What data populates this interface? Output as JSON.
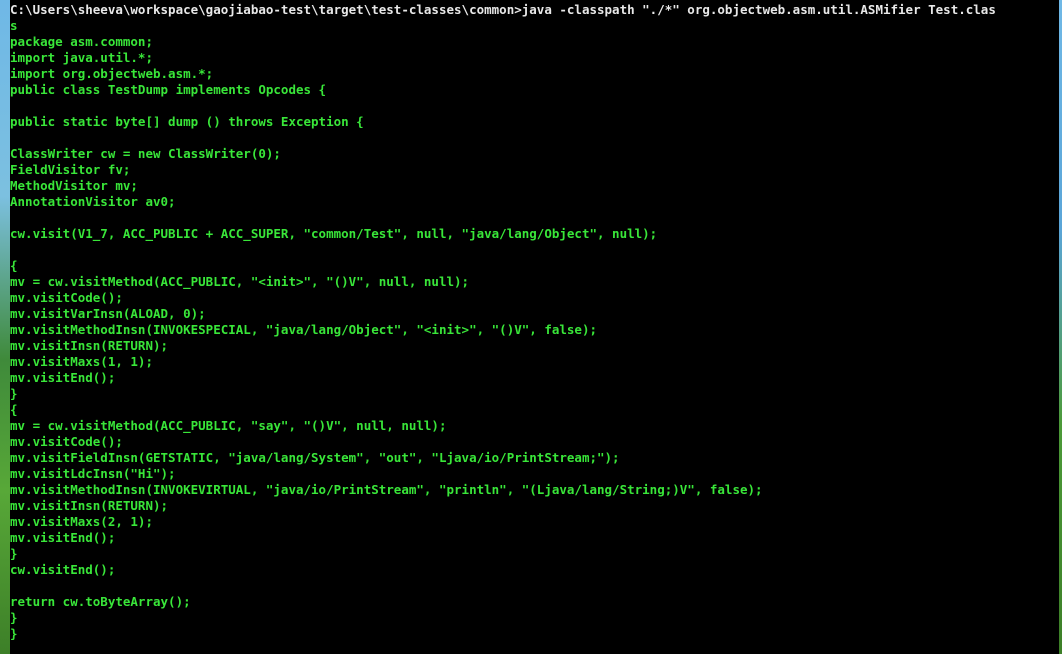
{
  "console": {
    "prompt_line": "C:\\Users\\sheeva\\workspace\\gaojiabao-test\\target\\test-classes\\common>java -classpath \"./*\" org.objectweb.asm.util.ASMifier Test.clas",
    "prompt_wrap": "s",
    "lines": [
      "package asm.common;",
      "import java.util.*;",
      "import org.objectweb.asm.*;",
      "public class TestDump implements Opcodes {",
      "",
      "public static byte[] dump () throws Exception {",
      "",
      "ClassWriter cw = new ClassWriter(0);",
      "FieldVisitor fv;",
      "MethodVisitor mv;",
      "AnnotationVisitor av0;",
      "",
      "cw.visit(V1_7, ACC_PUBLIC + ACC_SUPER, \"common/Test\", null, \"java/lang/Object\", null);",
      "",
      "{",
      "mv = cw.visitMethod(ACC_PUBLIC, \"<init>\", \"()V\", null, null);",
      "mv.visitCode();",
      "mv.visitVarInsn(ALOAD, 0);",
      "mv.visitMethodInsn(INVOKESPECIAL, \"java/lang/Object\", \"<init>\", \"()V\", false);",
      "mv.visitInsn(RETURN);",
      "mv.visitMaxs(1, 1);",
      "mv.visitEnd();",
      "}",
      "{",
      "mv = cw.visitMethod(ACC_PUBLIC, \"say\", \"()V\", null, null);",
      "mv.visitCode();",
      "mv.visitFieldInsn(GETSTATIC, \"java/lang/System\", \"out\", \"Ljava/io/PrintStream;\");",
      "mv.visitLdcInsn(\"Hi\");",
      "mv.visitMethodInsn(INVOKEVIRTUAL, \"java/io/PrintStream\", \"println\", \"(Ljava/lang/String;)V\", false);",
      "mv.visitInsn(RETURN);",
      "mv.visitMaxs(2, 1);",
      "mv.visitEnd();",
      "}",
      "cw.visitEnd();",
      "",
      "return cw.toByteArray();",
      "}",
      "}"
    ]
  }
}
